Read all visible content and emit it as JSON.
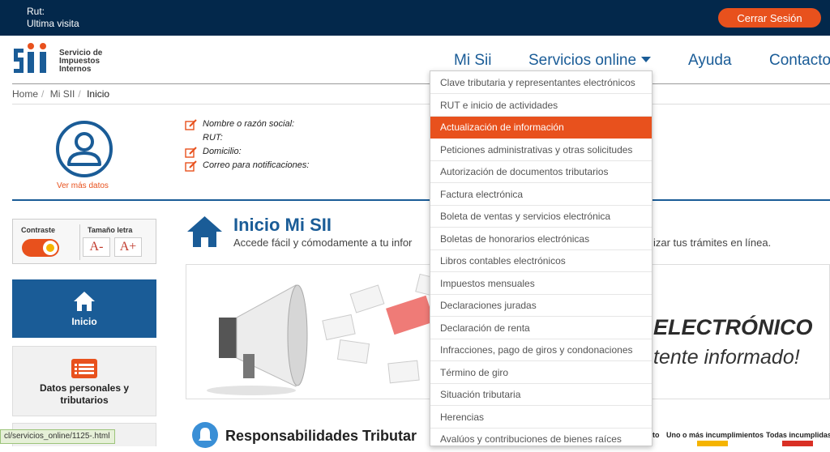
{
  "topbar": {
    "rut_label": "Rut:",
    "ultima_visita_label": "Ultima visita",
    "logout_label": "Cerrar Sesión"
  },
  "logo": {
    "line1": "Servicio de",
    "line2": "Impuestos",
    "line3": "Internos"
  },
  "nav": {
    "mi_sii": "Mi Sii",
    "servicios": "Servicios online",
    "ayuda": "Ayuda",
    "contacto": "Contacto"
  },
  "breadcrumb": [
    "Home",
    "Mi SII",
    "Inicio"
  ],
  "profile": {
    "ver_mas": "Ver más datos",
    "fields": [
      "Nombre o razón social:",
      "RUT:",
      "Domicilio:",
      "Correo para notificaciones:"
    ]
  },
  "accessibility": {
    "contraste": "Contraste",
    "tamano": "Tamaño letra",
    "decrease": "A-",
    "increase": "A+"
  },
  "sidebar": {
    "inicio": "Inicio",
    "datos_line1": "Datos personales y",
    "datos_line2": "tributarios"
  },
  "main": {
    "title": "Inicio Mi SII",
    "subtitle_left": "Accede fácil y cómodamente a tu infor",
    "subtitle_right": "izar tus trámites en línea.",
    "banner_big": "ELECTRÓNICO",
    "banner_small": "tente informado!",
    "responsabilidades": "Responsabilidades Tributar",
    "legend_left": "to",
    "legend_uno": "Uno o más incumplimientos",
    "legend_todas": "Todas incumplidas"
  },
  "colors": {
    "navy": "#03284b",
    "orange": "#e8511d",
    "blue": "#1a5c97",
    "legend_uno": "#f5b400",
    "legend_todas": "#d93025"
  },
  "status_url": "cl/servicios_online/1125-.html",
  "dropdown": {
    "active_index": 2,
    "items": [
      "Clave tributaria y representantes electrónicos",
      "RUT e inicio de actividades",
      "Actualización de información",
      "Peticiones administrativas y otras solicitudes",
      "Autorización de documentos tributarios",
      "Factura electrónica",
      "Boleta de ventas y servicios electrónica",
      "Boletas de honorarios electrónicas",
      "Libros contables electrónicos",
      "Impuestos mensuales",
      "Declaraciones juradas",
      "Declaración de renta",
      "Infracciones, pago de giros y condonaciones",
      "Término de giro",
      "Situación tributaria",
      "Herencias",
      "Avalúos y contribuciones de bienes raíces"
    ]
  }
}
